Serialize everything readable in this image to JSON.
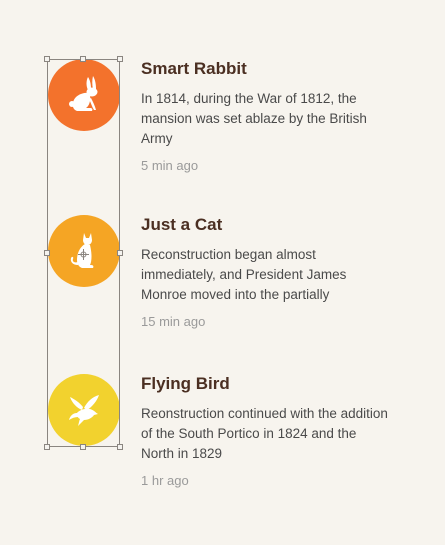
{
  "colors": {
    "background": "#f7f4ee",
    "title": "#4b2f22",
    "description": "#4a4a4a",
    "time": "#9a9a9a",
    "avatar_rabbit": "#f3722c",
    "avatar_cat": "#f5a524",
    "avatar_bird": "#f2d22e",
    "icon": "#ffffff"
  },
  "items": [
    {
      "title": "Smart Rabbit",
      "description": "In 1814, during the War of 1812, the mansion was set ablaze by the British Army",
      "time": "5 min ago",
      "icon": "rabbit-icon"
    },
    {
      "title": "Just a Cat",
      "description": "Reconstruction began almost immediately, and President James Monroe moved into the partially",
      "time": "15 min ago",
      "icon": "cat-icon"
    },
    {
      "title": "Flying Bird",
      "description": "Reonstruction continued with the addition of the South Portico in 1824 and the North in 1829",
      "time": "1 hr ago",
      "icon": "bird-icon"
    }
  ]
}
